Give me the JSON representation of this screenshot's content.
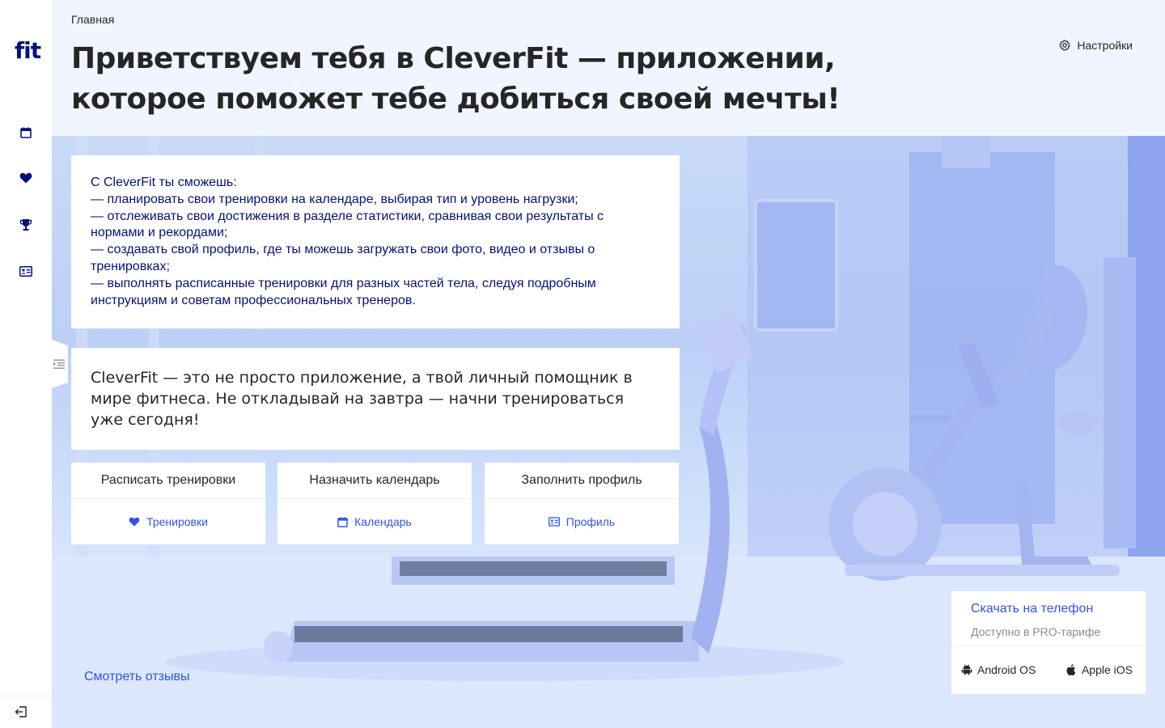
{
  "sidebar": {
    "logo": "fit",
    "items": [
      {
        "name": "calendar",
        "icon": "calendar-icon"
      },
      {
        "name": "workouts",
        "icon": "heart-icon"
      },
      {
        "name": "achievements",
        "icon": "trophy-icon"
      },
      {
        "name": "profile",
        "icon": "id-card-icon"
      }
    ],
    "logout_icon": "logout-icon",
    "collapse_icon": "menu-unfold-icon"
  },
  "header": {
    "breadcrumb": "Главная",
    "title": "Приветствуем тебя в CleverFit — приложении, которое поможет тебе добиться своей мечты!",
    "settings_label": "Настройки",
    "settings_icon": "gear-icon"
  },
  "features_card": {
    "text": "С CleverFit ты сможешь:\n— планировать свои тренировки на календаре, выбирая тип и уровень нагрузки;\n— отслеживать свои достижения в разделе статистики, сравнивая свои результаты с нормами и рекордами;\n— создавать свой профиль, где ты можешь загружать свои фото, видео и отзывы о тренировках;\n— выполнять расписанные тренировки для разных частей тела, следуя подробным инструкциям и советам профессиональных тренеров."
  },
  "quote_card": {
    "text": "CleverFit — это не просто приложение, а твой личный помощник в мире фитнеса. Не откладывай на завтра — начни тренироваться уже сегодня!"
  },
  "actions": [
    {
      "title": "Расписать тренировки",
      "link": "Тренировки",
      "icon": "heart-icon"
    },
    {
      "title": "Назначить календарь",
      "link": "Календарь",
      "icon": "calendar-icon"
    },
    {
      "title": "Заполнить профиль",
      "link": "Профиль",
      "icon": "id-card-icon"
    }
  ],
  "reviews_link": "Смотреть отзывы",
  "download": {
    "title": "Скачать на телефон",
    "subtitle": "Доступно в PRO-тарифе",
    "android": "Android OS",
    "ios": "Apple iOS"
  },
  "colors": {
    "primary": "#2f54eb",
    "dark_blue": "#061178",
    "background": "#f0f5ff"
  }
}
